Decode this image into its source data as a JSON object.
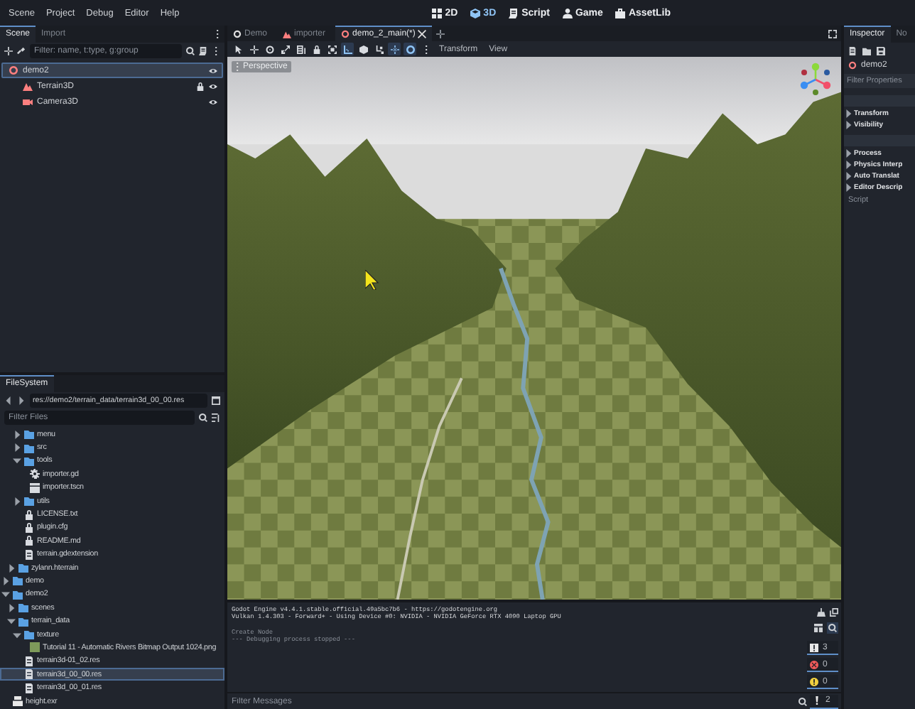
{
  "menu": [
    "Scene",
    "Project",
    "Debug",
    "Editor",
    "Help"
  ],
  "workspaces": [
    {
      "label": "2D",
      "kind": "flat",
      "selected": false
    },
    {
      "label": "3D",
      "kind": "spatial",
      "selected": true
    },
    {
      "label": "Script",
      "kind": "script",
      "selected": false
    },
    {
      "label": "Game",
      "kind": "game",
      "selected": false
    },
    {
      "label": "AssetLib",
      "kind": "assetlib",
      "selected": false
    }
  ],
  "scene_dock": {
    "tabs": [
      {
        "label": "Scene",
        "selected": true
      },
      {
        "label": "Import",
        "selected": false
      }
    ],
    "filter": {
      "placeholder": "Filter: name, t:type, g:group"
    },
    "tree": [
      {
        "name": "demo2",
        "kind": "root",
        "selected": true,
        "locked": false,
        "children": [
          {
            "name": "Terrain3D",
            "kind": "terrain",
            "selected": false,
            "locked": true
          },
          {
            "name": "Camera3D",
            "kind": "camera",
            "selected": false,
            "locked": false
          }
        ]
      }
    ]
  },
  "filesystem": {
    "tab": "FileSystem",
    "path": "res://demo2/terrain_data/terrain3d_00_00.res",
    "filter": {
      "placeholder": "Filter Files"
    },
    "tree": [
      {
        "children": [
          {
            "children": [
              {
                "name": "menu",
                "kind": "folder",
                "expanded": false,
                "selected": false
              },
              {
                "name": "src",
                "kind": "folder",
                "expanded": false,
                "selected": false
              },
              {
                "name": "tools",
                "kind": "folder",
                "expanded": true,
                "selected": false,
                "children": [
                  {
                    "name": "importer.gd",
                    "kind": "script",
                    "selected": false
                  },
                  {
                    "name": "importer.tscn",
                    "kind": "scene",
                    "selected": false
                  }
                ]
              },
              {
                "name": "utils",
                "kind": "folder",
                "expanded": false,
                "selected": false
              },
              {
                "name": "LICENSE.txt",
                "kind": "text",
                "selected": false
              },
              {
                "name": "plugin.cfg",
                "kind": "text",
                "selected": false
              },
              {
                "name": "README.md",
                "kind": "text",
                "selected": false
              },
              {
                "name": "terrain.gdextension",
                "kind": "file",
                "selected": false
              }
            ]
          },
          {
            "name": "zylann.hterrain",
            "kind": "folder",
            "expanded": false,
            "selected": false
          }
        ]
      },
      {
        "name": "demo",
        "kind": "folder",
        "expanded": false,
        "selected": false
      },
      {
        "name": "demo2",
        "kind": "folder",
        "expanded": true,
        "selected": false,
        "children": [
          {
            "name": "scenes",
            "kind": "folder",
            "expanded": false,
            "selected": false
          },
          {
            "name": "terrain_data",
            "kind": "folder",
            "expanded": true,
            "selected": false,
            "children": [
              {
                "name": "texture",
                "kind": "folder",
                "expanded": true,
                "selected": false,
                "children": [
                  {
                    "name": "Tutorial 11 - Automatic Rivers Bitmap Output 1024.png",
                    "kind": "image",
                    "selected": false
                  }
                ]
              },
              {
                "name": "terrain3d-01_02.res",
                "kind": "file",
                "selected": false
              },
              {
                "name": "terrain3d_00_00.res",
                "kind": "file",
                "selected": true
              },
              {
                "name": "terrain3d_00_01.res",
                "kind": "file",
                "selected": false
              }
            ]
          }
        ]
      },
      {
        "name": "height.exr",
        "kind": "exr",
        "selected": false
      }
    ]
  },
  "editor_tabs": [
    {
      "label": "Demo",
      "kind": "scene",
      "selected": false
    },
    {
      "label": "importer",
      "kind": "terrain",
      "selected": false
    },
    {
      "label": "demo_2_main(*)",
      "kind": "scene",
      "selected": true
    }
  ],
  "toolbar": {
    "tools": [
      {
        "kind": "select",
        "on": false
      },
      {
        "kind": "move",
        "on": false
      },
      {
        "kind": "rotate",
        "on": false
      },
      {
        "kind": "scale",
        "on": false
      },
      {
        "kind": "list",
        "on": false
      },
      {
        "kind": "lock",
        "on": false
      },
      {
        "kind": "group",
        "on": false
      },
      {
        "kind": "ruler",
        "on": true
      },
      {
        "kind": "cube",
        "on": false
      },
      {
        "kind": "bone",
        "on": false
      },
      {
        "kind": "local",
        "on": true
      },
      {
        "kind": "snap",
        "on": true
      },
      {
        "kind": "more",
        "on": false
      }
    ],
    "menus": [
      "Transform",
      "View"
    ]
  },
  "viewport": {
    "view_button": "Perspective"
  },
  "output": {
    "blocks": [
      {
        "kind": "info",
        "lines": [
          "Godot Engine v4.4.1.stable.official.49a5bc7b6 - https://godotengine.org",
          "Vulkan 1.4.303 - Forward+ - Using Device #0: NVIDIA - NVIDIA GeForce RTX 4090 Laptop GPU"
        ]
      },
      {
        "kind": "dim",
        "lines": [
          "Create Node",
          "--- Debugging process stopped ---"
        ]
      }
    ],
    "filter": {
      "placeholder": "Filter Messages"
    },
    "counters": [
      {
        "kind": "message",
        "count": "3"
      },
      {
        "kind": "error",
        "count": "0"
      },
      {
        "kind": "warning",
        "count": "0"
      },
      {
        "kind": "editor",
        "count": "2"
      }
    ]
  },
  "inspector": {
    "tabs": [
      {
        "label": "Inspector",
        "selected": true
      },
      {
        "label": "No",
        "selected": false
      }
    ],
    "node": "demo2",
    "filter": {
      "placeholder": "Filter Properties"
    },
    "groups": [
      [
        "Transform",
        "Visibility"
      ],
      [
        "Process",
        "Physics Interp",
        "Auto Translat",
        "Editor Descrip"
      ]
    ],
    "script_label": "Script"
  }
}
